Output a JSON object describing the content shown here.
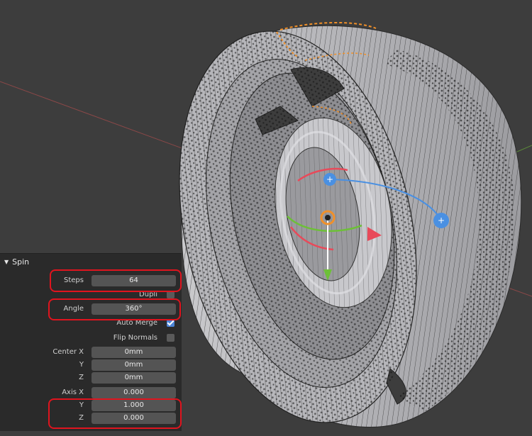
{
  "panel": {
    "title": "Spin",
    "steps": {
      "label": "Steps",
      "value": "64"
    },
    "dupli": {
      "label": "Dupli",
      "checked": false
    },
    "angle": {
      "label": "Angle",
      "value": "360°"
    },
    "auto_merge": {
      "label": "Auto Merge",
      "checked": true
    },
    "flip_normals": {
      "label": "Flip Normals",
      "checked": false
    },
    "center": {
      "label_x": "Center X",
      "x": "0mm",
      "label_y": "Y",
      "y": "0mm",
      "label_z": "Z",
      "z": "0mm"
    },
    "axis": {
      "label_x": "Axis X",
      "x": "0.000",
      "label_y": "Y",
      "y": "1.000",
      "label_z": "Z",
      "z": "0.000"
    }
  },
  "colors": {
    "viewport_bg": "#3d3d3d",
    "mesh": "#a8a8ac",
    "vertex": "#111111",
    "selection": "#f0902a",
    "highlight": "#e0141e",
    "gizmo_blue": "#4a90e2",
    "gizmo_red": "#e84a5a",
    "gizmo_green": "#6dc038"
  }
}
